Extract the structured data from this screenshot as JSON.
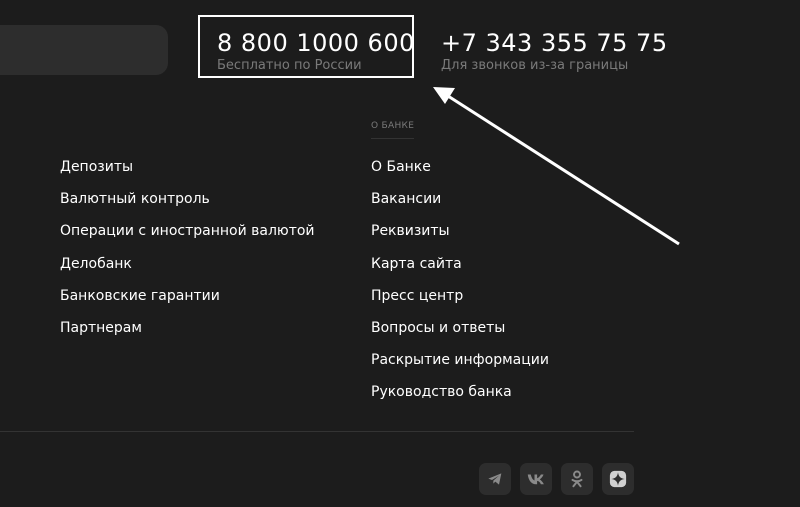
{
  "contacts": {
    "russia_phone": "8 800 1000 600",
    "russia_caption": "Бесплатно по России",
    "intl_phone": "+7 343 355 75 75",
    "intl_caption": "Для звонков из-за границы"
  },
  "footer": {
    "left_links": [
      "Депозиты",
      "Валютный контроль",
      "Операции с иностранной валютой",
      "Делобанк",
      "Банковские гарантии",
      "Партнерам"
    ],
    "about_heading": "О БАНКЕ",
    "right_links": [
      "О Банке",
      "Вакансии",
      "Реквизиты",
      "Карта сайта",
      "Пресс центр",
      "Вопросы и ответы",
      "Раскрытие информации",
      "Руководство банка"
    ]
  },
  "social": [
    {
      "icon": "telegram-icon"
    },
    {
      "icon": "vk-icon"
    },
    {
      "icon": "odnoklassniki-icon"
    },
    {
      "icon": "dzen-icon"
    }
  ],
  "colors": {
    "background": "#1c1c1c",
    "panel": "#2d2d2d",
    "text": "#ffffff",
    "muted": "#7a7a7a",
    "annotation": "#ffffff"
  }
}
